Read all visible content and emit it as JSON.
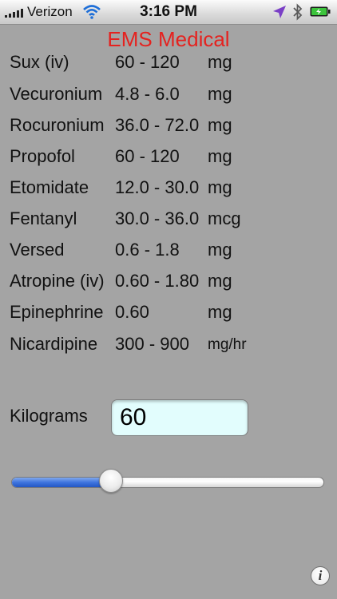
{
  "status_bar": {
    "carrier": "Verizon",
    "time": "3:16 PM",
    "signal_bars": 5,
    "icons": [
      "signal-icon",
      "wifi-icon",
      "location-arrow-icon",
      "bluetooth-icon",
      "battery-charging-icon"
    ]
  },
  "title": "EMS Medical",
  "colors": {
    "background": "#a4a4a4",
    "title": "#e5221f",
    "input_background": "#e2fdfd",
    "slider_fill": "#3e74df"
  },
  "drugs": [
    {
      "name": "Sux (iv)",
      "dose": "60 - 120",
      "unit": "mg"
    },
    {
      "name": "Vecuronium",
      "dose": "4.8 - 6.0",
      "unit": "mg"
    },
    {
      "name": "Rocuronium",
      "dose": "36.0 - 72.0",
      "unit": "mg"
    },
    {
      "name": "Propofol",
      "dose": "60 - 120",
      "unit": "mg"
    },
    {
      "name": "Etomidate",
      "dose": "12.0 - 30.0",
      "unit": "mg"
    },
    {
      "name": "Fentanyl",
      "dose": "30.0 - 36.0",
      "unit": "mcg"
    },
    {
      "name": "Versed",
      "dose": "0.6 - 1.8",
      "unit": "mg"
    },
    {
      "name": "Atropine (iv)",
      "dose": "0.60 - 1.80",
      "unit": "mg"
    },
    {
      "name": "Epinephrine",
      "dose": "0.60",
      "unit": "mg"
    },
    {
      "name": "Nicardipine",
      "dose": "300 - 900",
      "unit": "mg/hr"
    }
  ],
  "weight": {
    "label": "Kilograms",
    "value": "60"
  },
  "slider": {
    "fraction": 0.3
  },
  "info_button": {
    "glyph": "i"
  }
}
